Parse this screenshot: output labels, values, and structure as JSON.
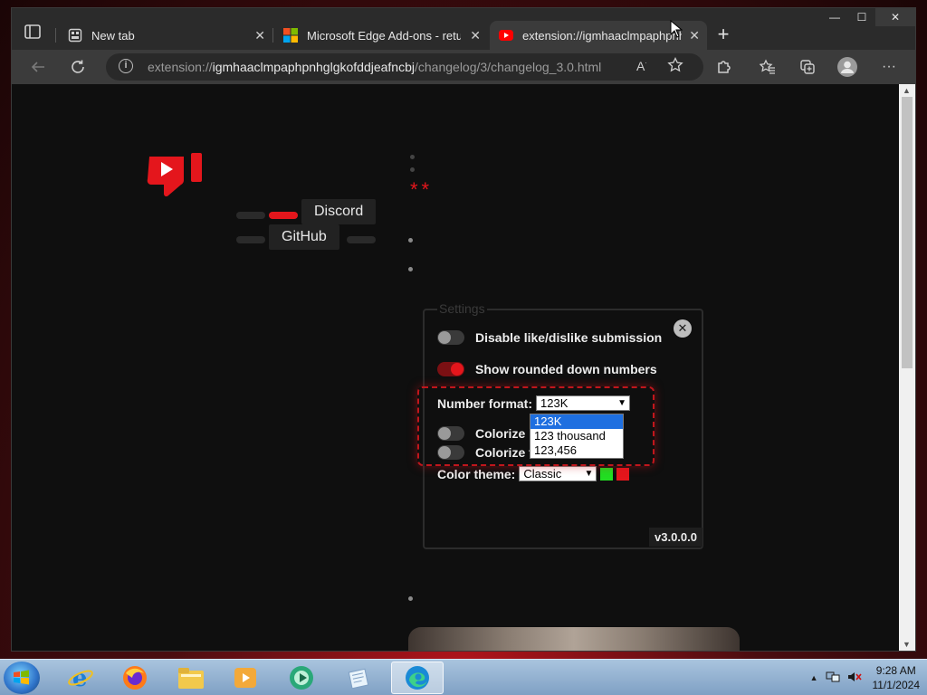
{
  "window": {
    "min": "—",
    "max": "☐",
    "close": "✕"
  },
  "tabs": [
    {
      "title": "New tab",
      "close": "✕"
    },
    {
      "title": "Microsoft Edge Add-ons - return",
      "close": "✕"
    },
    {
      "title": "extension://igmhaaclmpaphpnh",
      "close": "✕"
    }
  ],
  "new_tab": "+",
  "address": {
    "scheme": "extension://",
    "host": "igmhaaclmpaphpnhglgkofddjeafncbj",
    "path": "/changelog/3/changelog_3.0.html",
    "read_aloud": "A⁾"
  },
  "page": {
    "links": {
      "discord": "Discord",
      "github": "GitHub"
    },
    "stars": "**",
    "settings": {
      "legend": "Settings",
      "close": "✕",
      "disable_label": "Disable like/dislike submission",
      "rounded_label": "Show rounded down numbers",
      "number_format_label": "Number format:",
      "number_format_value": "123K",
      "number_format_options": [
        "123K",
        "123 thousand",
        "123,456"
      ],
      "colorize_ratio_label": "Colorize r",
      "colorize_thumbs_label": "Colorize t",
      "color_theme_label": "Color theme:",
      "color_theme_value": "Classic",
      "colors": {
        "like": "#22dd22",
        "dislike": "#e4161c"
      },
      "version": "v3.0.0.0"
    }
  },
  "taskbar": {
    "time": "9:28 AM",
    "date": "11/1/2024",
    "tray_up": "▲"
  }
}
